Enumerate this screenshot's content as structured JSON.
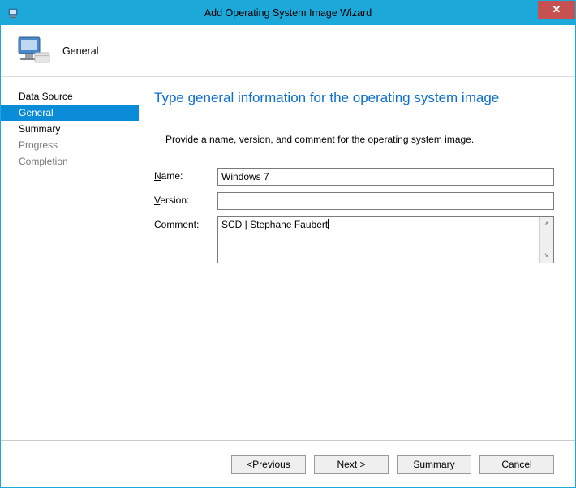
{
  "window": {
    "title": "Add Operating System Image Wizard"
  },
  "header": {
    "label": "General"
  },
  "sidebar": {
    "items": [
      {
        "label": "Data Source",
        "state": "done"
      },
      {
        "label": "General",
        "state": "active"
      },
      {
        "label": "Summary",
        "state": "done"
      },
      {
        "label": "Progress",
        "state": "inactive"
      },
      {
        "label": "Completion",
        "state": "inactive"
      }
    ]
  },
  "content": {
    "heading": "Type general information for the operating system image",
    "instruction": "Provide a name, version, and comment for the operating system image.",
    "fields": {
      "name": {
        "label": "Name:",
        "value": "Windows 7"
      },
      "version": {
        "label": "Version:",
        "value": ""
      },
      "comment": {
        "label": "Comment:",
        "value": "SCD | Stephane Faubert"
      }
    }
  },
  "footer": {
    "previous": "Previous",
    "next": "Next",
    "summary": "Summary",
    "cancel": "Cancel"
  }
}
